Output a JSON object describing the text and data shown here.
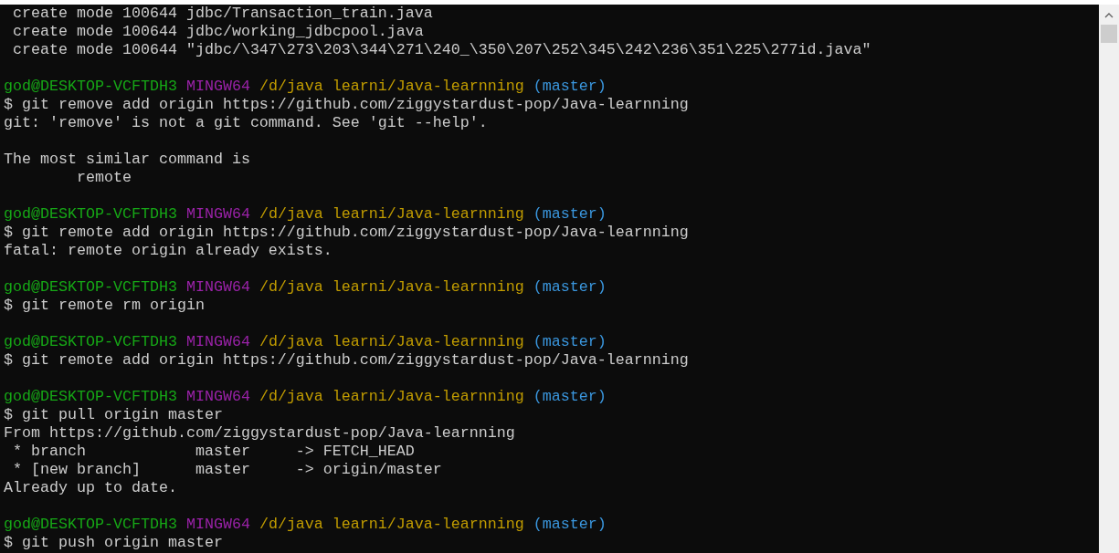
{
  "terminal": {
    "lines": [
      {
        "kind": "output",
        "text": " create mode 100644 jdbc/Transaction_train.java"
      },
      {
        "kind": "output",
        "text": " create mode 100644 jdbc/working_jdbcpool.java"
      },
      {
        "kind": "output",
        "text": " create mode 100644 \"jdbc/\\347\\273\\203\\344\\271\\240_\\350\\207\\252\\345\\242\\236\\351\\225\\277id.java\""
      },
      {
        "kind": "blank"
      },
      {
        "kind": "prompt",
        "user": "god@DESKTOP-VCFTDH3",
        "shell": "MINGW64",
        "path": "/d/java learni/Java-learnning",
        "branch": "(master)"
      },
      {
        "kind": "output",
        "text": "$ git remove add origin https://github.com/ziggystardust-pop/Java-learnning"
      },
      {
        "kind": "output",
        "text": "git: 'remove' is not a git command. See 'git --help'."
      },
      {
        "kind": "blank"
      },
      {
        "kind": "output",
        "text": "The most similar command is"
      },
      {
        "kind": "output",
        "text": "        remote"
      },
      {
        "kind": "blank"
      },
      {
        "kind": "prompt",
        "user": "god@DESKTOP-VCFTDH3",
        "shell": "MINGW64",
        "path": "/d/java learni/Java-learnning",
        "branch": "(master)"
      },
      {
        "kind": "output",
        "text": "$ git remote add origin https://github.com/ziggystardust-pop/Java-learnning"
      },
      {
        "kind": "output",
        "text": "fatal: remote origin already exists."
      },
      {
        "kind": "blank"
      },
      {
        "kind": "prompt",
        "user": "god@DESKTOP-VCFTDH3",
        "shell": "MINGW64",
        "path": "/d/java learni/Java-learnning",
        "branch": "(master)"
      },
      {
        "kind": "output",
        "text": "$ git remote rm origin"
      },
      {
        "kind": "blank"
      },
      {
        "kind": "prompt",
        "user": "god@DESKTOP-VCFTDH3",
        "shell": "MINGW64",
        "path": "/d/java learni/Java-learnning",
        "branch": "(master)"
      },
      {
        "kind": "output",
        "text": "$ git remote add origin https://github.com/ziggystardust-pop/Java-learnning"
      },
      {
        "kind": "blank"
      },
      {
        "kind": "prompt",
        "user": "god@DESKTOP-VCFTDH3",
        "shell": "MINGW64",
        "path": "/d/java learni/Java-learnning",
        "branch": "(master)"
      },
      {
        "kind": "output",
        "text": "$ git pull origin master"
      },
      {
        "kind": "output",
        "text": "From https://github.com/ziggystardust-pop/Java-learnning"
      },
      {
        "kind": "output",
        "text": " * branch            master     -> FETCH_HEAD"
      },
      {
        "kind": "output",
        "text": " * [new branch]      master     -> origin/master"
      },
      {
        "kind": "output",
        "text": "Already up to date."
      },
      {
        "kind": "blank"
      },
      {
        "kind": "prompt",
        "user": "god@DESKTOP-VCFTDH3",
        "shell": "MINGW64",
        "path": "/d/java learni/Java-learnning",
        "branch": "(master)"
      },
      {
        "kind": "output",
        "text": "$ git push origin master"
      }
    ]
  }
}
